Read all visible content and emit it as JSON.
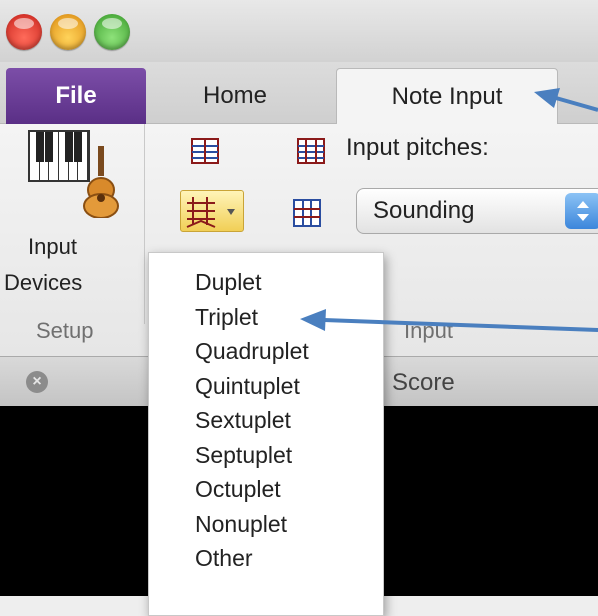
{
  "tabs": {
    "file": "File",
    "home": "Home",
    "note_input": "Note Input"
  },
  "ribbon": {
    "input_devices_line1": "Input",
    "input_devices_line2": "Devices",
    "setup_group": "Setup",
    "input_pitches_label": "Input pitches:",
    "pitch_select_value": "Sounding",
    "input_group": "Input"
  },
  "document": {
    "title_fragment": "l Score"
  },
  "tuplet_menu": {
    "items": [
      "Duplet",
      "Triplet",
      "Quadruplet",
      "Quintuplet",
      "Sextuplet",
      "Septuplet",
      "Octuplet",
      "Nonuplet",
      "Other"
    ]
  },
  "colors": {
    "file_tab": "#6a3d96",
    "annotation_arrow": "#4a7fbf"
  }
}
